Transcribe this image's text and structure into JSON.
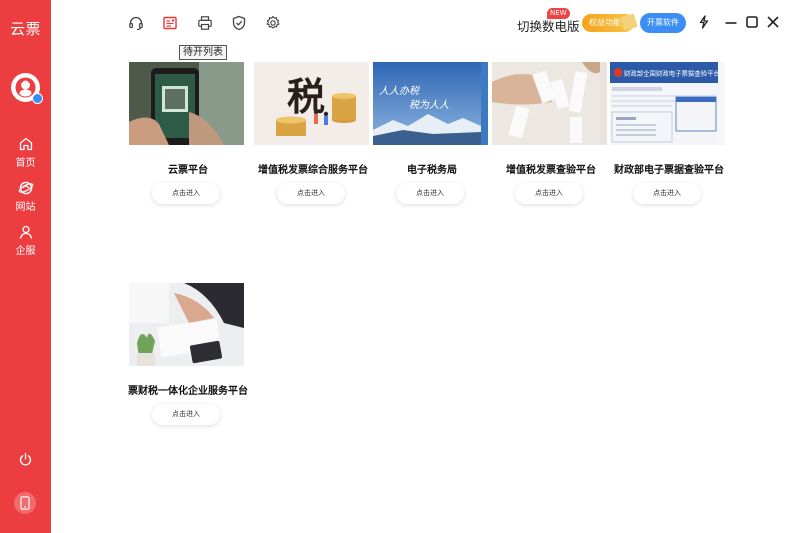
{
  "sidebar": {
    "brand": "云票",
    "nav": [
      {
        "label": "首页",
        "icon": "home-icon"
      },
      {
        "label": "网站",
        "icon": "globe-icon"
      },
      {
        "label": "企服",
        "icon": "user-icon"
      }
    ],
    "colors": {
      "bg": "#ec3d40"
    }
  },
  "toolbar": {
    "tooltip": "待开列表",
    "icons": [
      "headset-icon",
      "pending-list-icon",
      "printer-icon",
      "shield-check-icon",
      "gear-icon"
    ],
    "switch_label": "切换数电版",
    "new_badge": "NEW",
    "benefit_label": "权益功能",
    "invoice_label": "开票软件"
  },
  "cards": [
    {
      "title": "云票平台",
      "button": "点击进入"
    },
    {
      "title": "增值税发票综合服务平台",
      "button": "点击进入",
      "image_text": "税"
    },
    {
      "title": "电子税务局",
      "button": "点击进入",
      "image_text": "人人办税 税为人人"
    },
    {
      "title": "增值税发票查验平台",
      "button": "点击进入"
    },
    {
      "title": "财政部电子票据查验平台",
      "button": "点击进入",
      "image_text": "财政部全国财政电子票据查验平台"
    },
    {
      "title": "票财税一体化企业服务平台",
      "button": "点击进入"
    }
  ]
}
